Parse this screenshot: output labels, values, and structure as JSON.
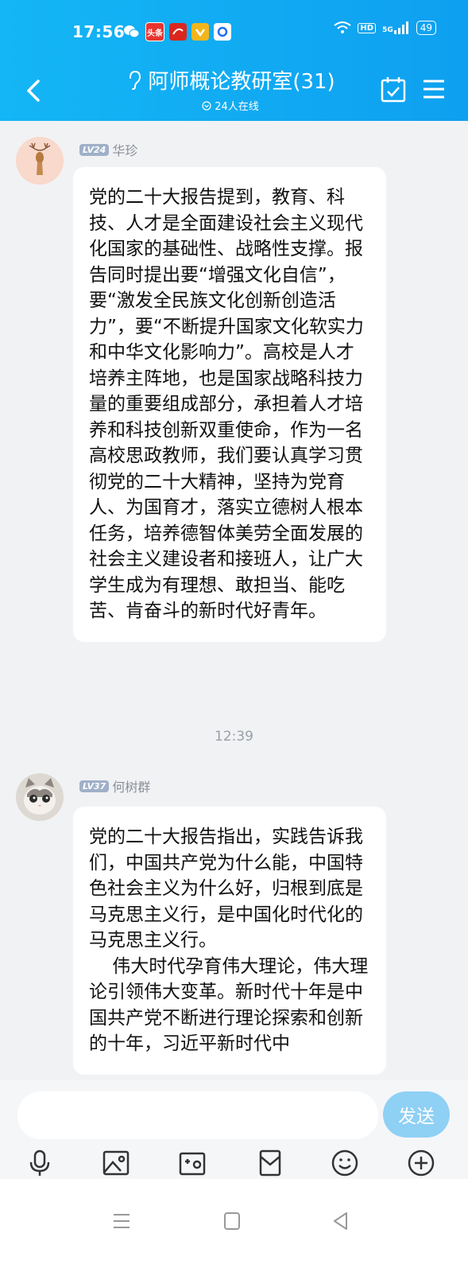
{
  "status_bar": {
    "time": "17:56",
    "notif_icons": [
      "wechat-icon",
      "toutiao-icon",
      "app-red-icon",
      "app-yellow-icon",
      "app-blue-icon"
    ],
    "toutiao_label": "头条",
    "hd_label": "HD",
    "signal_label": "5G",
    "battery": "49"
  },
  "header": {
    "title": "阿师概论教研室(31)",
    "online": "24人在线",
    "accent": "#0ea0f0"
  },
  "messages": [
    {
      "level": "LV24",
      "sender": "华珍",
      "text": "党的二十大报告提到，教育、科技、人才是全面建设社会主义现代化国家的基础性、战略性支撑。报告同时提出要“增强文化自信”，要“激发全民族文化创新创造活力”，要“不断提升国家文化软实力和中华文化影响力”。高校是人才培养主阵地，也是国家战略科技力量的重要组成部分，承担着人才培养和科技创新双重使命，作为一名高校思政教师，我们要认真学习贯彻党的二十大精神，坚持为党育人、为国育才，落实立德树人根本任务，培养德智体美劳全面发展的社会主义建设者和接班人，让广大学生成为有理想、敢担当、能吃苦、肯奋斗的新时代好青年。"
    },
    {
      "level": "LV37",
      "sender": "何树群",
      "text": "党的二十大报告指出，实践告诉我们，中国共产党为什么能，中国特色社会主义为什么好，归根到底是马克思主义行，是中国化时代化的马克思主义行。\n    伟大时代孕育伟大理论，伟大理论引领伟大变革。新时代十年是中国共产党不断进行理论探索和创新的十年，习近平新时代中"
    }
  ],
  "time_separator": "12:39",
  "input": {
    "value": "",
    "send_label": "发送"
  },
  "toolbar_icons": [
    "microphone-icon",
    "image-icon",
    "camera-icon",
    "red-packet-icon",
    "emoji-icon",
    "plus-icon"
  ],
  "nav_icons": [
    "recent-apps-icon",
    "home-icon",
    "back-icon"
  ]
}
